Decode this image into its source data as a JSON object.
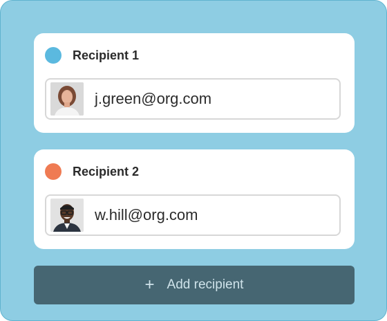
{
  "recipients": [
    {
      "title": "Recipient 1",
      "email": "j.green@org.com",
      "dot_color": "#5bb9df",
      "avatar": "woman-portrait"
    },
    {
      "title": "Recipient 2",
      "email": "w.hill@org.com",
      "dot_color": "#ef7b53",
      "avatar": "man-portrait"
    }
  ],
  "add_button": {
    "icon": "plus-icon",
    "label": "Add recipient"
  },
  "colors": {
    "panel_background": "#8ecde3",
    "card_background": "#ffffff",
    "button_background": "#466672",
    "button_text": "#cfe3ea"
  }
}
